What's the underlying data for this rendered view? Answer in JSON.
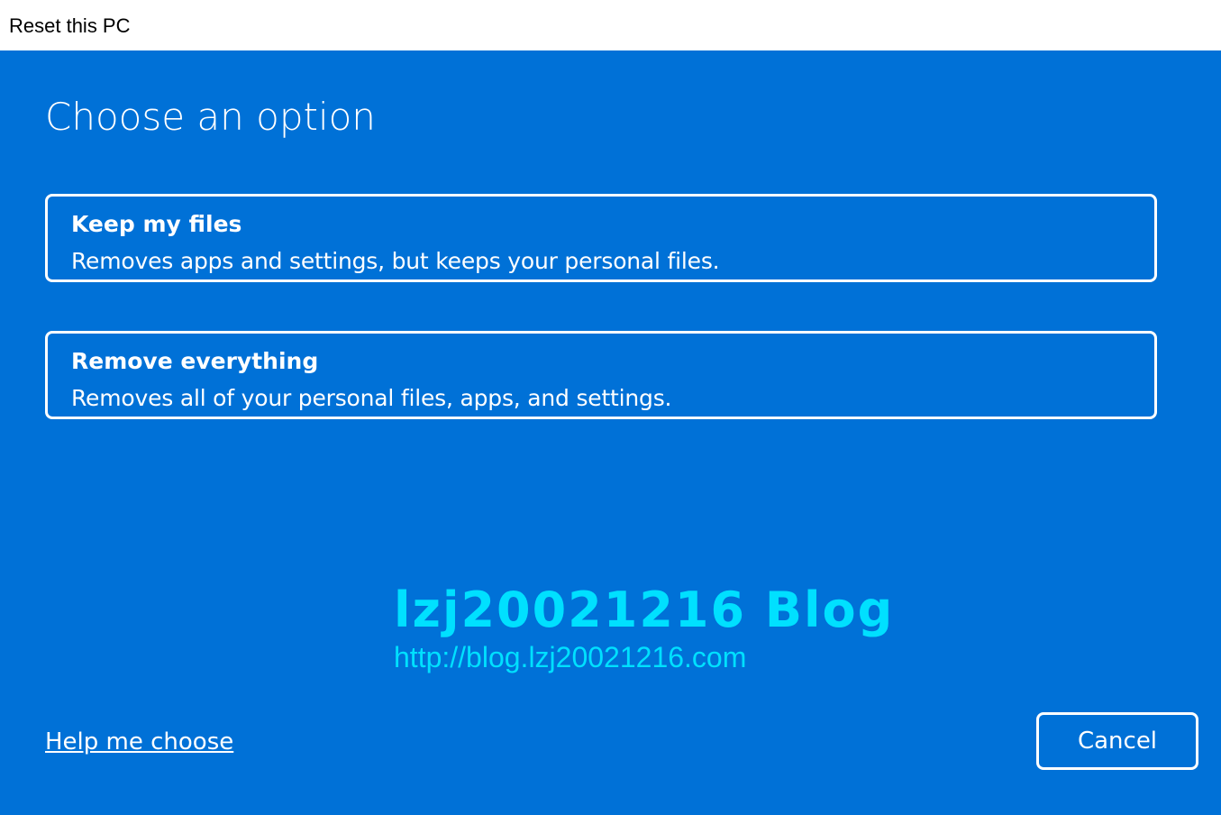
{
  "window": {
    "title": "Reset this PC"
  },
  "main": {
    "heading": "Choose an option",
    "options": [
      {
        "title": "Keep my files",
        "description": "Removes apps and settings, but keeps your personal files."
      },
      {
        "title": "Remove everything",
        "description": "Removes all of your personal files, apps, and settings."
      }
    ]
  },
  "watermark": {
    "title": "lzj20021216 Blog",
    "url": "http://blog.lzj20021216.com"
  },
  "footer": {
    "help_link": "Help me choose",
    "cancel_label": "Cancel"
  },
  "colors": {
    "background": "#0071d7",
    "titlebar": "#ffffff",
    "text": "#ffffff",
    "watermark": "#00e0ff"
  }
}
